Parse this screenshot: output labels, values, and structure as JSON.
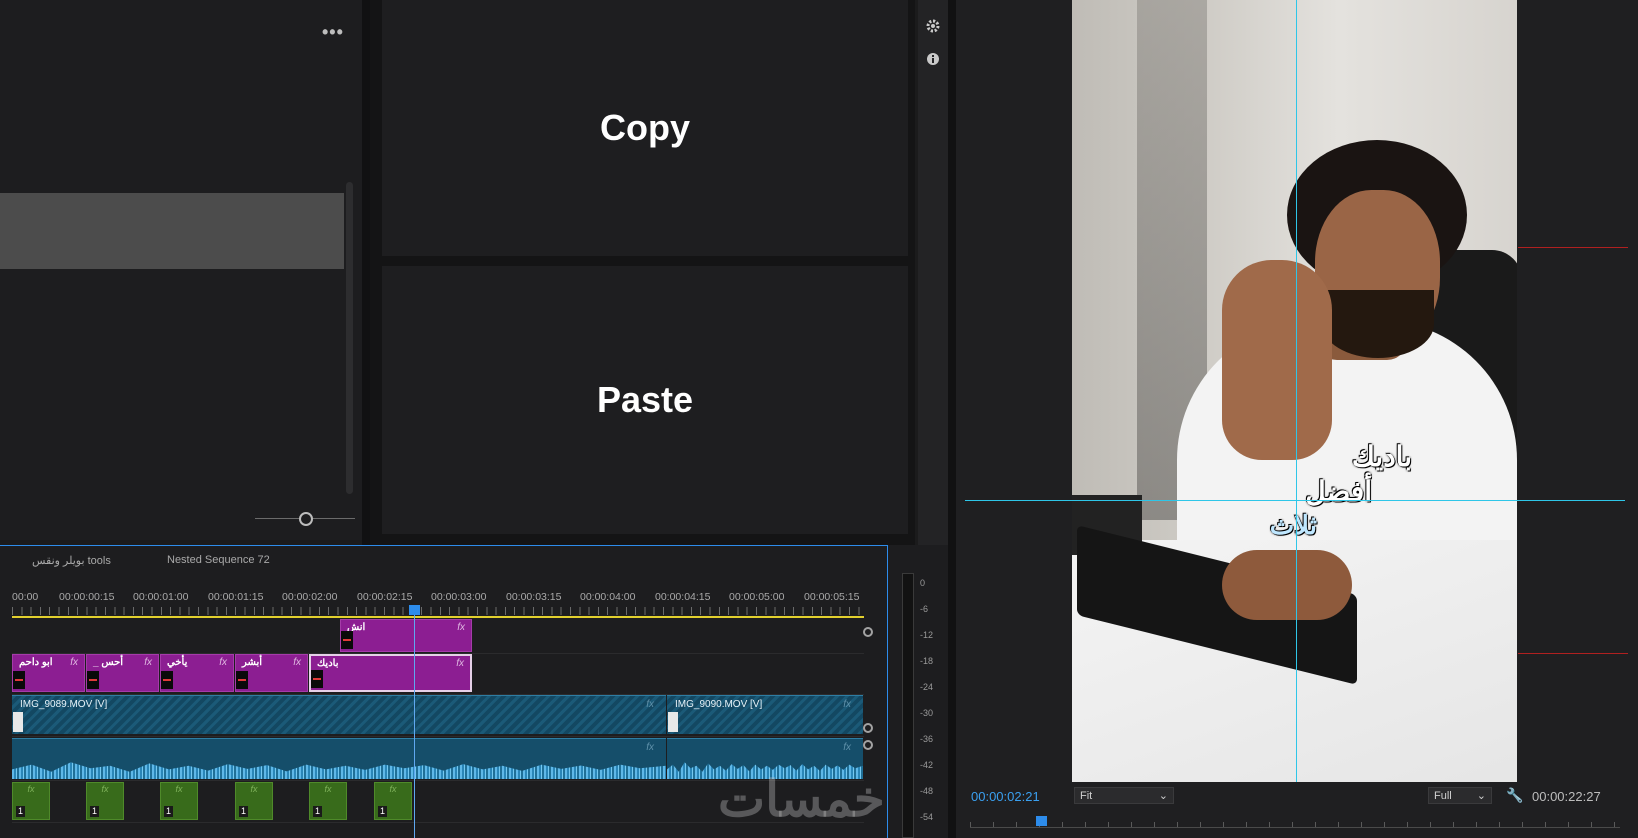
{
  "source_panel": {
    "more_label": "•••"
  },
  "copy_paste": {
    "copy_label": "Copy",
    "paste_label": "Paste"
  },
  "side_icons": [
    "gear-icon",
    "info-icon"
  ],
  "timeline": {
    "tabs": [
      "بويلر ونقس tools",
      "Nested Sequence 72"
    ],
    "ruler_labels": [
      "00:00",
      "00:00:00:15",
      "00:00:01:00",
      "00:00:01:15",
      "00:00:02:00",
      "00:00:02:15",
      "00:00:03:00",
      "00:00:03:15",
      "00:00:04:00",
      "00:00:04:15",
      "00:00:05:00",
      "00:00:05:15"
    ],
    "v3_clip": {
      "label": "انش",
      "fx": "fx"
    },
    "v2_clips": [
      {
        "label": "ابو داحم",
        "fx": "fx"
      },
      {
        "label": "_ أحس",
        "fx": "fx"
      },
      {
        "label": "يأخي",
        "fx": "fx"
      },
      {
        "label": "أبشر",
        "fx": "fx"
      },
      {
        "label": "باديك",
        "fx": "fx"
      }
    ],
    "v1_clips": [
      {
        "label": "IMG_9089.MOV [V]",
        "fx": "fx"
      },
      {
        "label": "IMG_9090.MOV [V]",
        "fx": "fx"
      }
    ],
    "audio_fx": "fx",
    "green_clips": [
      {
        "fx": "fx",
        "num": "1"
      },
      {
        "fx": "fx",
        "num": "1"
      },
      {
        "fx": "fx",
        "num": "1"
      },
      {
        "fx": "fx",
        "num": "1"
      },
      {
        "fx": "fx",
        "num": "1"
      },
      {
        "fx": "fx",
        "num": "1"
      }
    ],
    "meter_labels": [
      "0",
      "-6",
      "-12",
      "-18",
      "-24",
      "-30",
      "-36",
      "-42",
      "-48",
      "-54"
    ],
    "watermark": "خمسات"
  },
  "program_monitor": {
    "captions": [
      "باديك",
      "أفضل",
      "ثلاث"
    ],
    "current_time": "00:00:02:21",
    "fit_select": "Fit",
    "quality_select": "Full",
    "duration": "00:00:22:27"
  },
  "colors": {
    "accent": "#2d8ceb",
    "caption_clip": "#8c1e92",
    "video_clip": "#1b5a78",
    "audio_clip": "#154e6a",
    "guide": "#2ec6e8"
  }
}
